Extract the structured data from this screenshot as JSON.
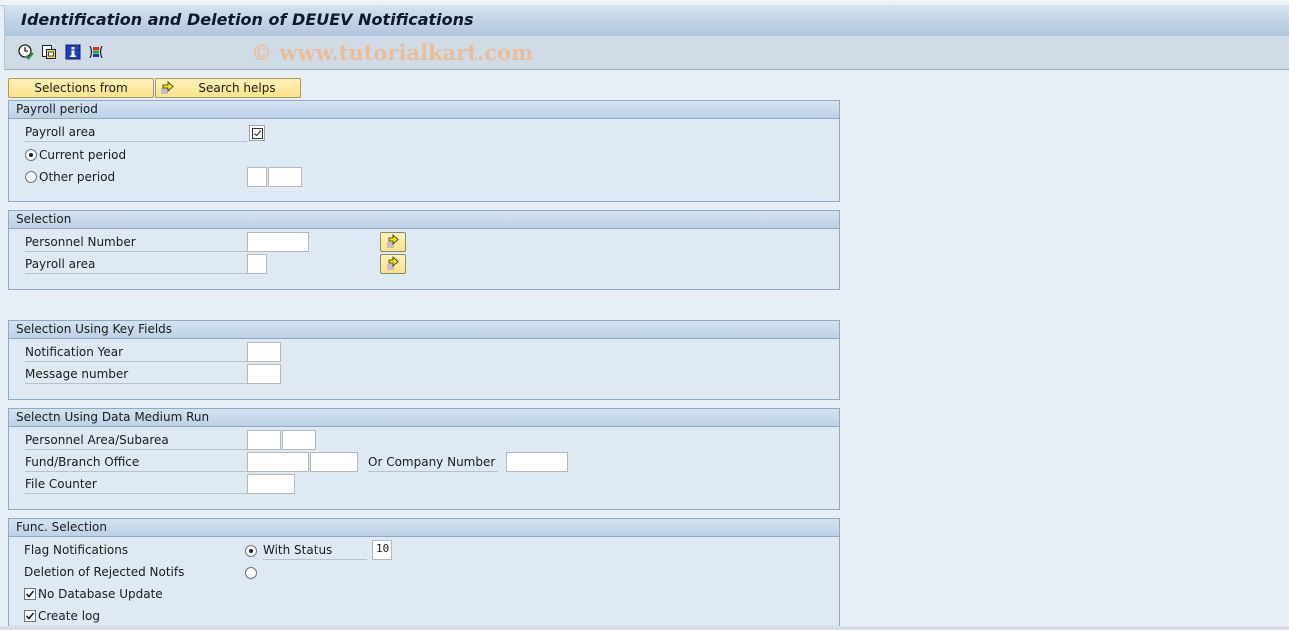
{
  "window": {
    "title": "Identification and Deletion of DEUEV Notifications"
  },
  "toolbar": {
    "icons": [
      "execute-icon",
      "copy-variant-icon",
      "info-icon",
      "layout-icon"
    ],
    "watermark": "© www.tutorialkart.com"
  },
  "buttons": {
    "selections_from": "Selections from",
    "search_helps": "Search helps"
  },
  "groups": {
    "payroll_period": {
      "title": "Payroll period",
      "payroll_area_label": "Payroll area",
      "payroll_area_checked": true,
      "current_period_label": "Current period",
      "current_period_selected": true,
      "other_period_label": "Other period",
      "other_period_selected": false,
      "other_period_value1": "",
      "other_period_value2": ""
    },
    "selection": {
      "title": "Selection",
      "personnel_number_label": "Personnel Number",
      "personnel_number_value": "",
      "payroll_area_label": "Payroll area",
      "payroll_area_value": ""
    },
    "key_fields": {
      "title": "Selection Using Key Fields",
      "notification_year_label": "Notification Year",
      "notification_year_value": "",
      "message_number_label": "Message number",
      "message_number_value": ""
    },
    "data_medium_run": {
      "title": "Selectn Using Data Medium Run",
      "personnel_area_label": "Personnel Area/Subarea",
      "personnel_area_value": "",
      "personnel_subarea_value": "",
      "fund_branch_label": "Fund/Branch Office",
      "fund_value": "",
      "branch_value": "",
      "company_number_label": "Or Company Number",
      "company_number_value": "",
      "file_counter_label": "File Counter",
      "file_counter_value": ""
    },
    "func_selection": {
      "title": "Func. Selection",
      "flag_notifications_label": "Flag Notifications",
      "flag_notifications_selected": true,
      "with_status_label": "With Status",
      "with_status_value": "10",
      "deletion_rejected_label": "Deletion of Rejected Notifs",
      "deletion_rejected_selected": false,
      "no_db_update_label": "No Database Update",
      "no_db_update_checked": true,
      "create_log_label": "Create log",
      "create_log_checked": true
    }
  }
}
